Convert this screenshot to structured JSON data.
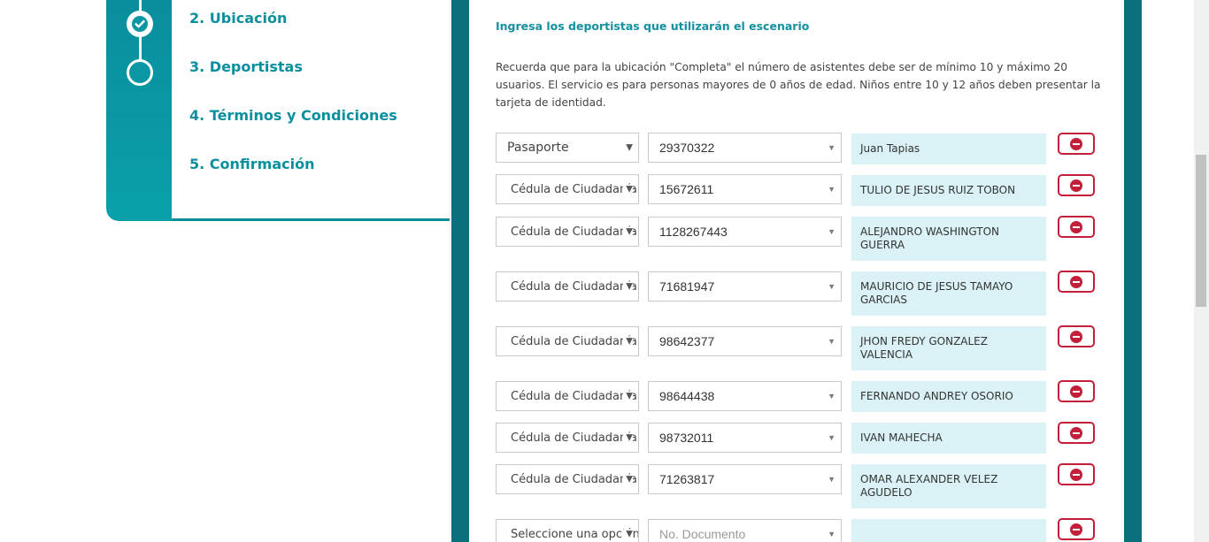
{
  "steps": [
    {
      "label": "2. Ubicación",
      "status": "done"
    },
    {
      "label": "3. Deportistas",
      "status": "current"
    },
    {
      "label": "4. Términos y Condiciones",
      "status": "pending"
    },
    {
      "label": "5. Confirmación",
      "status": "pending"
    }
  ],
  "form": {
    "title": "Ingresa los deportistas que utilizarán el escenario",
    "instructions": "Recuerda que para la ubicación \"Completa\" el número de asistentes debe ser de mínimo 10 y máximo 20 usuarios. El servicio es para personas mayores de 0 años de edad. Niños entre 10 y 12 años deben presentar la tarjeta de identidad.",
    "rows": [
      {
        "doc_type": "Pasaporte",
        "doc_number": "29370322",
        "name": "Juan Tapias"
      },
      {
        "doc_type": "Cédula de Ciudadanía",
        "doc_number": "15672611",
        "name": "TULIO DE JESUS RUIZ TOBON"
      },
      {
        "doc_type": "Cédula de Ciudadanía",
        "doc_number": "1128267443",
        "name": "ALEJANDRO WASHINGTON GUERRA"
      },
      {
        "doc_type": "Cédula de Ciudadanía",
        "doc_number": "71681947",
        "name": "MAURICIO DE JESUS TAMAYO GARCIAS"
      },
      {
        "doc_type": "Cédula de Ciudadanía",
        "doc_number": "98642377",
        "name": "JHON FREDY GONZALEZ VALENCIA"
      },
      {
        "doc_type": "Cédula de Ciudadanía",
        "doc_number": "98644438",
        "name": "FERNANDO ANDREY OSORIO"
      },
      {
        "doc_type": "Cédula de Ciudadanía",
        "doc_number": "98732011",
        "name": "IVAN MAHECHA"
      },
      {
        "doc_type": "Cédula de Ciudadanía",
        "doc_number": "71263817",
        "name": "OMAR ALEXANDER VELEZ AGUDELO"
      }
    ],
    "empty_row": {
      "doc_type_placeholder": "Seleccione una opción",
      "doc_number_placeholder": "No. Documento",
      "name": ""
    }
  },
  "colors": {
    "accent": "#0a8f9f",
    "panel": "#0c6f7c",
    "name_fill": "#daf2f5",
    "remove": "#c2203a"
  }
}
